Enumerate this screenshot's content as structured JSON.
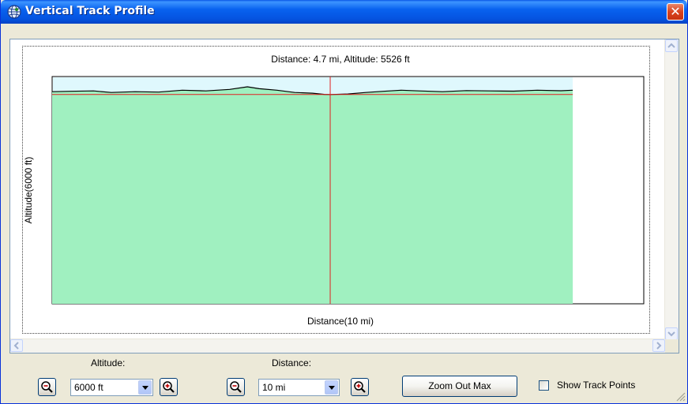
{
  "window": {
    "title": "Vertical Track Profile",
    "close_label": "✕",
    "title_icon": "globe-icon"
  },
  "colors": {
    "terrain_fill": "#a0f0c0",
    "sky_fill": "#dff8fd",
    "cursor_line": "#e02020",
    "profile_line": "#000000"
  },
  "chart": {
    "readout": "Distance: 4.7 mi, Altitude: 5526 ft",
    "ylabel": "Altitude(6000 ft)",
    "xlabel": "Distance(10 mi)"
  },
  "chart_data": {
    "type": "area",
    "title": "Distance: 4.7 mi, Altitude: 5526 ft",
    "xlabel": "Distance(10 mi)",
    "ylabel": "Altitude(6000 ft)",
    "xlim": [
      0,
      10
    ],
    "ylim": [
      0,
      6000
    ],
    "grid": false,
    "cursor": {
      "x": 4.7,
      "y": 5526
    },
    "x": [
      0,
      0.3,
      0.7,
      1.0,
      1.4,
      1.8,
      2.2,
      2.6,
      3.0,
      3.3,
      3.5,
      3.8,
      4.1,
      4.4,
      4.6,
      4.7,
      5.0,
      5.3,
      5.6,
      5.9,
      6.2,
      6.6,
      7.0,
      7.4,
      7.8,
      8.2,
      8.6,
      8.8
    ],
    "y": [
      5600,
      5610,
      5620,
      5580,
      5600,
      5590,
      5640,
      5620,
      5660,
      5730,
      5680,
      5640,
      5580,
      5560,
      5530,
      5526,
      5540,
      5580,
      5610,
      5640,
      5620,
      5600,
      5630,
      5620,
      5615,
      5640,
      5625,
      5640
    ]
  },
  "controls": {
    "altitude_label": "Altitude:",
    "altitude_value": "6000 ft",
    "distance_label": "Distance:",
    "distance_value": "10 mi",
    "zoom_out_max_label": "Zoom Out Max",
    "show_track_points_label": "Show Track Points",
    "show_track_points_checked": false
  }
}
